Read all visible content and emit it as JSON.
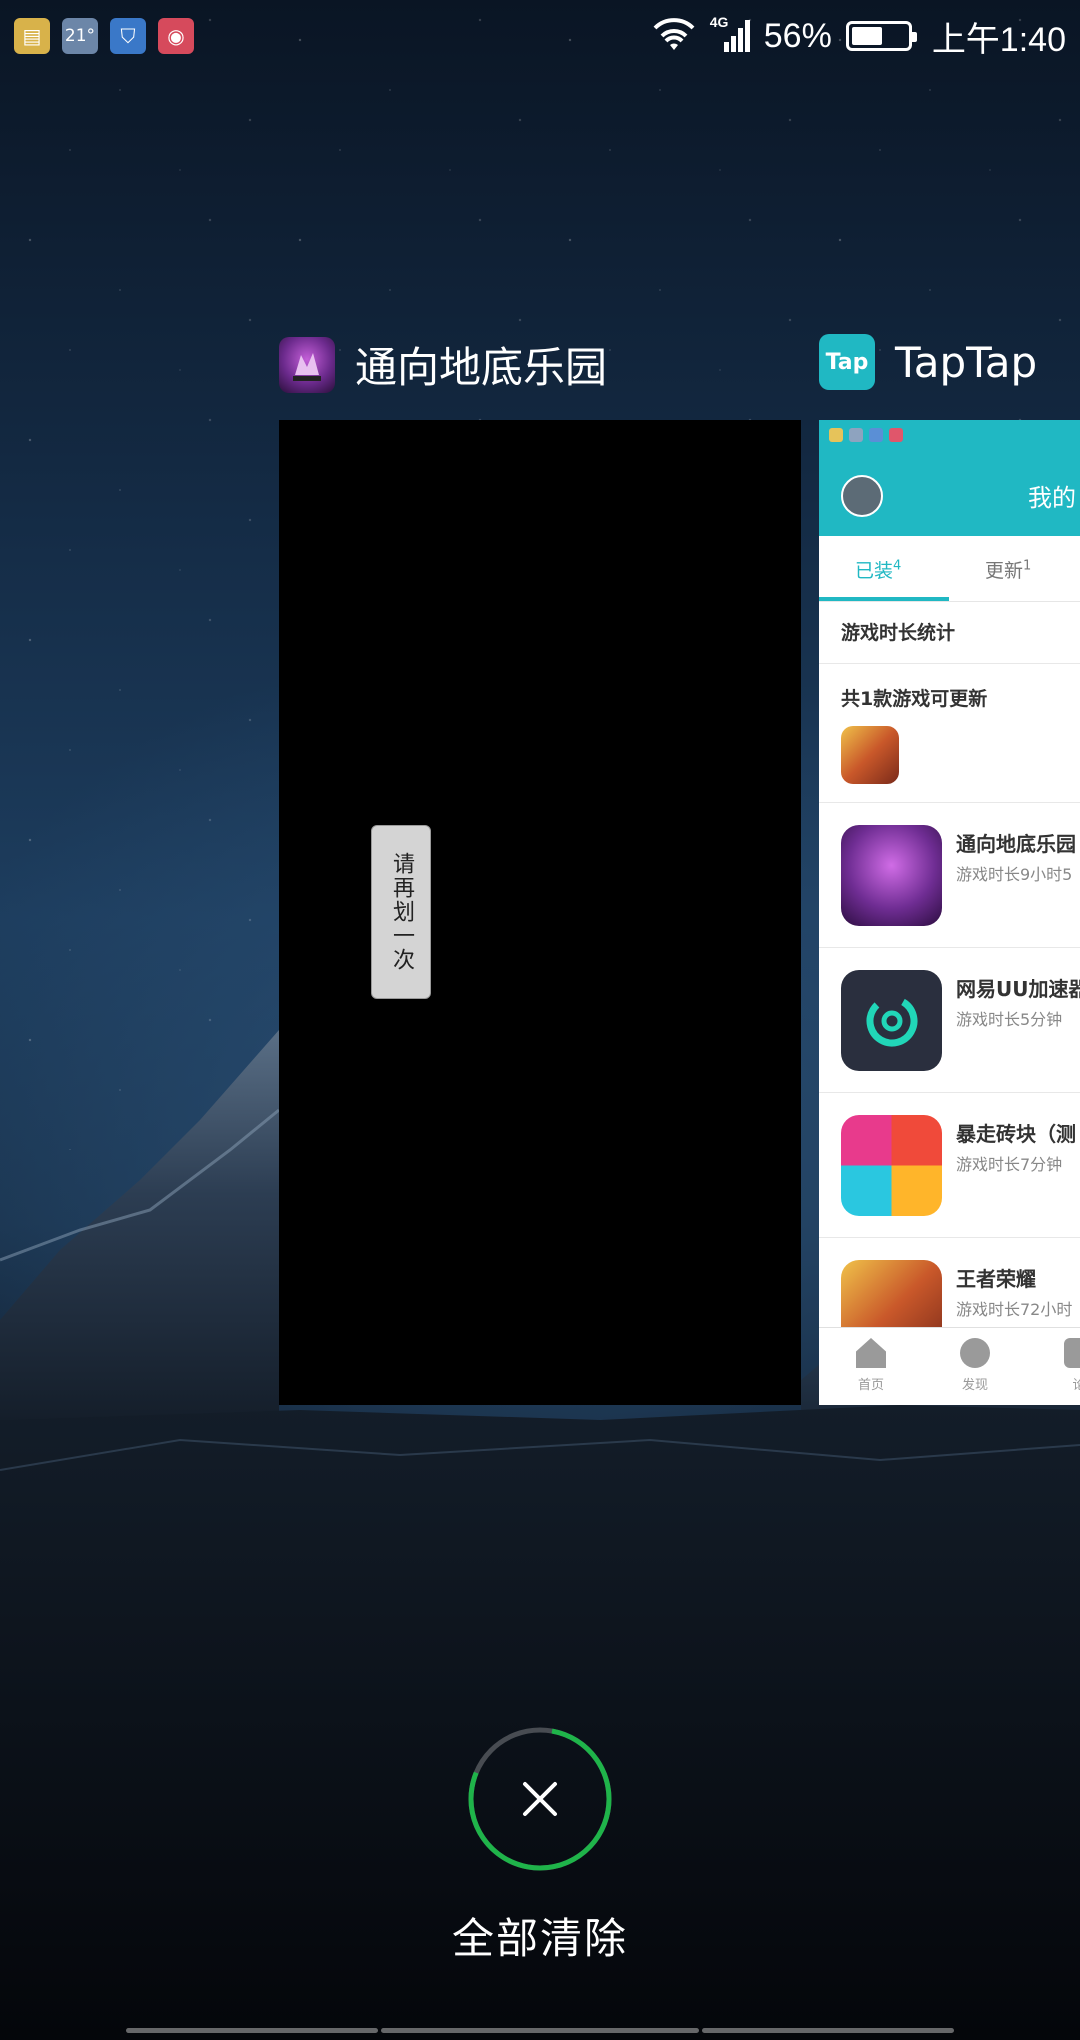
{
  "status_bar": {
    "notification_icons": [
      {
        "name": "folder-icon",
        "color": "#d8b24a",
        "glyph": "▤"
      },
      {
        "name": "temperature-icon",
        "color": "#6c86a8",
        "glyph": "21°"
      },
      {
        "name": "shield-icon",
        "color": "#3a78c8",
        "glyph": "⛉"
      },
      {
        "name": "record-icon",
        "color": "#d64a5c",
        "glyph": "◉"
      }
    ],
    "network": "4G",
    "battery_level_percent": 56,
    "battery": "56%",
    "time": "上午1:40"
  },
  "recents": {
    "card1": {
      "app_name": "通向地底乐园",
      "toast_text": "请再划一次"
    },
    "card2": {
      "app_name": "TapTap",
      "icon_text": "Tap",
      "accent_color": "#20b8c3",
      "header_title": "我的",
      "tabs": [
        {
          "label": "已装",
          "count": "4",
          "active": true
        },
        {
          "label": "更新",
          "count": "1",
          "active": false
        }
      ],
      "stats_label": "游戏时长统计",
      "update_label": "共1款游戏可更新",
      "games": [
        {
          "name": "通向地底乐园",
          "playtime": "游戏时长9小时5"
        },
        {
          "name": "网易UU加速器",
          "playtime": "游戏时长5分钟"
        },
        {
          "name": "暴走砖块（测",
          "playtime": "游戏时长7分钟"
        },
        {
          "name": "王者荣耀",
          "playtime": "游戏时长72小时"
        }
      ],
      "bottom_nav": [
        "首页",
        "发现",
        "论"
      ]
    }
  },
  "clear_all": {
    "label": "全部清除",
    "ring_color": "#1fb44a"
  }
}
